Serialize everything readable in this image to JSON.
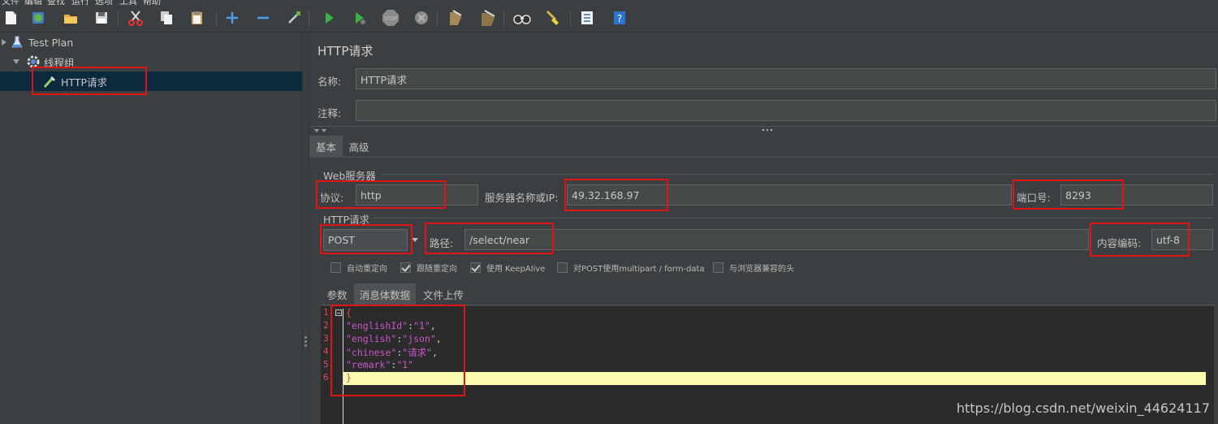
{
  "menubar": {
    "items": [
      "文件",
      "编辑",
      "查找",
      "运行",
      "选项",
      "工具",
      "帮助"
    ]
  },
  "toolbar": {
    "buttons": [
      "new-icon",
      "templates-icon",
      "open-icon",
      "save-icon",
      "cut-icon",
      "copy-icon",
      "paste-icon",
      "expand-icon",
      "collapse-icon",
      "toggle-icon",
      "start-icon",
      "start-no-pause-icon",
      "stop-icon",
      "shutdown-icon",
      "clear-icon",
      "clear-all-icon",
      "search-icon",
      "reset-search-icon",
      "function-helper-icon",
      "help-icon"
    ]
  },
  "tree": {
    "items": [
      {
        "label": "Test Plan",
        "icon": "flask-icon"
      },
      {
        "label": "线程组",
        "icon": "gear-icon"
      },
      {
        "label": "HTTP请求",
        "icon": "pipette-icon"
      }
    ]
  },
  "panel": {
    "title": "HTTP请求",
    "name_label": "名称:",
    "name_value": "HTTP请求",
    "comment_label": "注释:",
    "comment_value": "",
    "tabs": [
      "基本",
      "高级"
    ],
    "web_server": {
      "section_title": "Web服务器",
      "protocol_label": "协议:",
      "protocol_value": "http",
      "server_label": "服务器名称或IP:",
      "server_value": "49.32.168.97",
      "port_label": "端口号:",
      "port_value": "8293"
    },
    "http_request": {
      "section_title": "HTTP请求",
      "method_value": "POST",
      "path_label": "路径:",
      "path_value": "/select/near",
      "encoding_label": "内容编码:",
      "encoding_value": "utf-8"
    },
    "checkboxes": [
      {
        "label": "自动重定向",
        "checked": false
      },
      {
        "label": "跟随重定向",
        "checked": true
      },
      {
        "label": "使用 KeepAlive",
        "checked": true
      },
      {
        "label": "对POST使用multipart / form-data",
        "checked": false
      },
      {
        "label": "与浏览器兼容的头",
        "checked": false
      }
    ],
    "body_tabs": [
      "参数",
      "消息体数据",
      "文件上传"
    ],
    "body_lines": [
      {
        "num": "1",
        "text": "{"
      },
      {
        "num": "2",
        "key": "\"englishId\"",
        "val": "\"1\""
      },
      {
        "num": "3",
        "key": "\"english\"",
        "val": "\"json\""
      },
      {
        "num": "4",
        "key": "\"chinese\"",
        "val": "\"请求\""
      },
      {
        "num": "5",
        "key": "\"remark\"",
        "val": "\"1\"",
        "last": true
      },
      {
        "num": "6",
        "text": "}"
      }
    ]
  },
  "watermark": "https://blog.csdn.net/weixin_44624117",
  "colors": {
    "background": "#3c3f41",
    "highlight": "#fcfbb2",
    "annotation": "#e11313",
    "selection": "#0d293e"
  }
}
